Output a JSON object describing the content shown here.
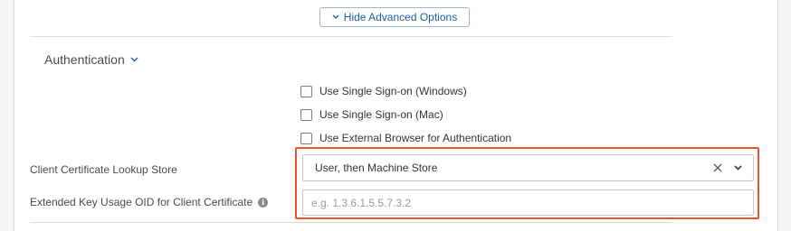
{
  "advanced_toggle": {
    "label": "Hide Advanced Options",
    "icon": "chevron-down-icon",
    "color": "#1a5e9e"
  },
  "authentication": {
    "title": "Authentication",
    "icon": "chevron-down-icon",
    "checkboxes": [
      {
        "label": "Use Single Sign-on (Windows)",
        "checked": false
      },
      {
        "label": "Use Single Sign-on (Mac)",
        "checked": false
      },
      {
        "label": "Use External Browser for Authentication",
        "checked": false
      }
    ]
  },
  "fields": {
    "cert_store": {
      "label": "Client Certificate Lookup Store",
      "value": "User, then Machine Store",
      "clear_icon": "close-icon",
      "caret_icon": "chevron-down-icon"
    },
    "eku_oid": {
      "label": "Extended Key Usage OID for Client Certificate",
      "info_icon": "info-icon",
      "value": "",
      "placeholder": "e.g. 1.3.6.1.5.5.7.3.2"
    }
  },
  "highlight_color": "#e8552d"
}
